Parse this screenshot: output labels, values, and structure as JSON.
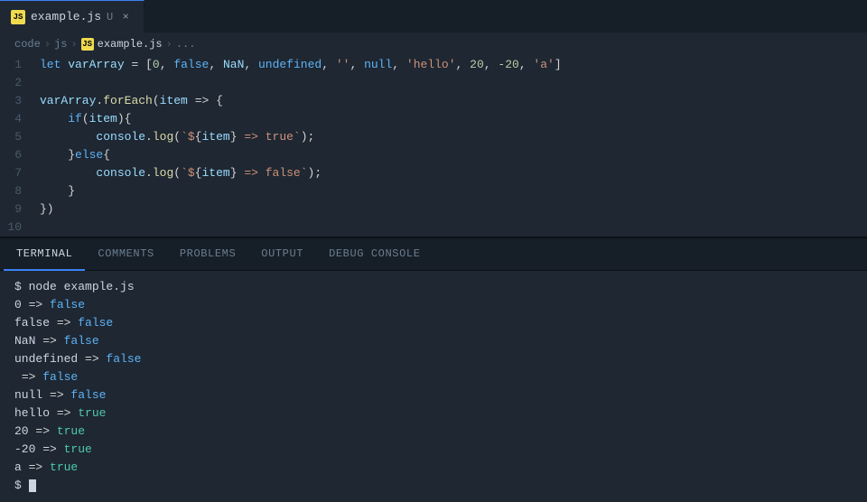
{
  "tab": {
    "filename": "example.js",
    "modified": "U",
    "js_label": "JS",
    "close_icon": "×"
  },
  "breadcrumb": {
    "parts": [
      "code",
      ">",
      "js",
      ">",
      "example.js",
      ">",
      "..."
    ]
  },
  "code": {
    "lines": [
      {
        "num": 1,
        "html": "<span class='kw'>let</span> <span class='var'>varArray</span> <span class='op'>=</span> <span class='punc'>[</span><span class='num'>0</span><span class='punc'>,</span> <span class='bool'>false</span><span class='punc'>,</span> <span class='var'>NaN</span><span class='punc'>,</span> <span class='bool'>undefined</span><span class='punc'>,</span> <span class='str'>''</span><span class='punc'>,</span> <span class='bool'>null</span><span class='punc'>,</span> <span class='str'>'hello'</span><span class='punc'>,</span> <span class='num'>20</span><span class='punc'>,</span> <span class='num'>-20</span><span class='punc'>,</span> <span class='str'>'a'</span><span class='punc'>]</span>"
      },
      {
        "num": 2,
        "html": ""
      },
      {
        "num": 3,
        "html": "<span class='var'>varArray</span><span class='op'>.</span><span class='fn'>forEach</span><span class='punc'>(</span><span class='var'>item</span> <span class='op'>=></span> <span class='punc'>{</span>"
      },
      {
        "num": 4,
        "html": "    <span class='kw'>if</span><span class='punc'>(</span><span class='var'>item</span><span class='punc'>){</span>"
      },
      {
        "num": 5,
        "html": "        <span class='var'>console</span><span class='op'>.</span><span class='fn'>log</span><span class='punc'>(</span><span class='str'>`$</span><span class='punc'>{</span><span class='var'>item</span><span class='punc'>}</span><span class='str'> => true`</span><span class='punc'>)</span><span class='punc'>;</span>"
      },
      {
        "num": 6,
        "html": "    <span class='punc'>}</span><span class='kw'>else</span><span class='punc'>{</span>"
      },
      {
        "num": 7,
        "html": "        <span class='var'>console</span><span class='op'>.</span><span class='fn'>log</span><span class='punc'>(</span><span class='str'>`$</span><span class='punc'>{</span><span class='var'>item</span><span class='punc'>}</span><span class='str'> => false`</span><span class='punc'>)</span><span class='punc'>;</span>"
      },
      {
        "num": 8,
        "html": "    <span class='punc'>}</span>"
      },
      {
        "num": 9,
        "html": "<span class='punc'>})</span>"
      },
      {
        "num": 10,
        "html": ""
      }
    ]
  },
  "panel_tabs": [
    "TERMINAL",
    "COMMENTS",
    "PROBLEMS",
    "OUTPUT",
    "DEBUG CONSOLE"
  ],
  "active_panel_tab": "TERMINAL",
  "terminal": {
    "command": "$ node example.js",
    "output": [
      {
        "line": "0 => false",
        "val_class": "t-false"
      },
      {
        "line": "false => false",
        "val_class": "t-false"
      },
      {
        "line": "NaN => false",
        "val_class": "t-false"
      },
      {
        "line": "undefined => false",
        "val_class": "t-false"
      },
      {
        "line": " => false",
        "val_class": "t-false"
      },
      {
        "line": "null => false",
        "val_class": "t-false"
      },
      {
        "line": "hello => true",
        "val_class": "t-true"
      },
      {
        "line": "20 => true",
        "val_class": "t-true"
      },
      {
        "line": "-20 => true",
        "val_class": "t-true"
      },
      {
        "line": "a => true",
        "val_class": "t-true"
      }
    ],
    "prompt": "$"
  }
}
